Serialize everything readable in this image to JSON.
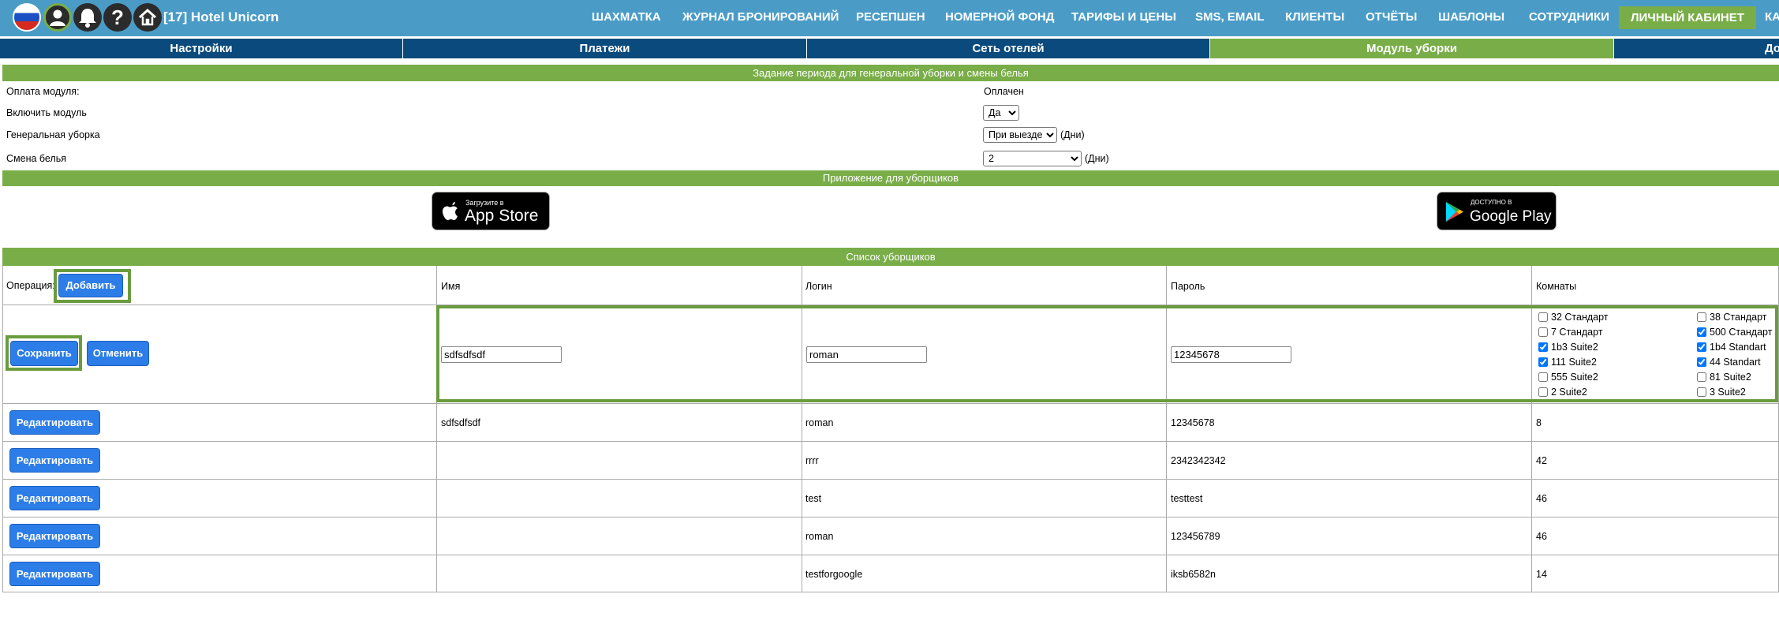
{
  "header": {
    "hotel": "[17] Hotel Unicorn",
    "nav": [
      "ШАХМАТКА",
      "ЖУРНАЛ БРОНИРОВАНИЙ",
      "РЕСЕПШЕН",
      "НОМЕРНОЙ ФОНД",
      "ТАРИФЫ И ЦЕНЫ",
      "SMS, EMAIL",
      "КЛИЕНТЫ",
      "ОТЧЁТЫ",
      "ШАБЛОНЫ",
      "СОТРУДНИКИ",
      "ЛИЧНЫЙ КАБИНЕТ",
      "КА"
    ],
    "active_nav": "ЛИЧНЫЙ КАБИНЕТ",
    "brand_color": "#4a9cc7",
    "accent_color": "#79ad48"
  },
  "tabs": [
    "Настройки",
    "Платежи",
    "Сеть отелей",
    "Модуль уборки",
    "До"
  ],
  "active_tab": "Модуль уборки",
  "period": {
    "title": "Задание периода для генеральной уборки и смены белья",
    "payment_label": "Оплата модуля:",
    "payment_value": "Оплачен",
    "enable_label": "Включить модуль",
    "enable_value": "Да",
    "general_label": "Генеральная уборка",
    "general_value": "При выезде",
    "days": "(Дни)",
    "linen_label": "Смена белья",
    "linen_value": "2"
  },
  "app": {
    "title": "Приложение для уборщиков",
    "appstore_small": "Загрузите в",
    "appstore_big": "App Store",
    "gplay_small": "ДОСТУПНО В",
    "gplay_big": "Google Play"
  },
  "cleaners": {
    "title": "Список уборщиков",
    "operation_label": "Операция:",
    "add": "Добавить",
    "col_name": "Имя",
    "col_login": "Логин",
    "col_password": "Пароль",
    "col_rooms": "Комнаты",
    "save": "Сохранить",
    "cancel": "Отменить",
    "edit": "Редактировать",
    "form": {
      "name": "sdfsdfsdf",
      "login": "roman",
      "password": "12345678"
    },
    "rooms": [
      {
        "label": "32 Стандарт",
        "checked": false
      },
      {
        "label": "38 Стандарт",
        "checked": false
      },
      {
        "label": "7 Стандарт",
        "checked": false
      },
      {
        "label": "500 Стандарт",
        "checked": true
      },
      {
        "label": "1b3 Suite2",
        "checked": true
      },
      {
        "label": "1b4 Standart",
        "checked": true
      },
      {
        "label": "111 Suite2",
        "checked": true
      },
      {
        "label": "44 Standart",
        "checked": true
      },
      {
        "label": "555 Suite2",
        "checked": false
      },
      {
        "label": "81 Suite2",
        "checked": false
      },
      {
        "label": "2 Suite2",
        "checked": false
      },
      {
        "label": "3 Suite2",
        "checked": false
      }
    ],
    "rows": [
      {
        "name": "sdfsdfsdf",
        "login": "roman",
        "password": "12345678",
        "rooms": "8"
      },
      {
        "name": "",
        "login": "rrrr",
        "password": "2342342342",
        "rooms": "42"
      },
      {
        "name": "",
        "login": "test",
        "password": "testtest",
        "rooms": "46"
      },
      {
        "name": "",
        "login": "roman",
        "password": "123456789",
        "rooms": "46"
      },
      {
        "name": "",
        "login": "testforgoogle",
        "password": "iksb6582n",
        "rooms": "14"
      }
    ]
  }
}
